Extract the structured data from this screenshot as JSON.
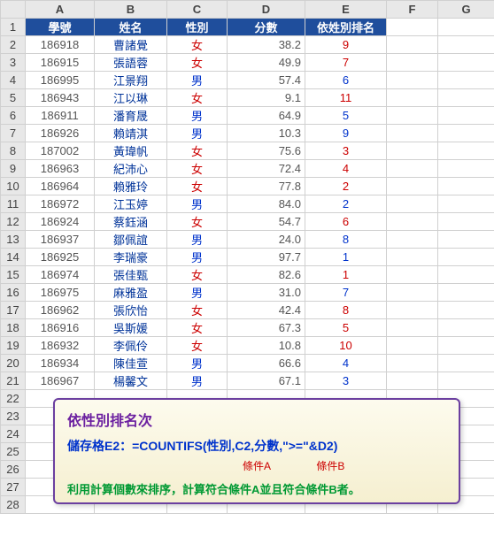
{
  "columns": [
    "A",
    "B",
    "C",
    "D",
    "E",
    "F",
    "G"
  ],
  "headers": {
    "A": "學號",
    "B": "姓名",
    "C": "性別",
    "D": "分數",
    "E": "依姓別排名"
  },
  "chart_data": {
    "type": "table",
    "title": "依性別排名次",
    "columns": [
      "學號",
      "姓名",
      "性別",
      "分數",
      "依姓別排名"
    ],
    "rows": [
      {
        "id": "186918",
        "name": "曹諸覺",
        "gender": "女",
        "score": 38.2,
        "rank": 9
      },
      {
        "id": "186915",
        "name": "張語蓉",
        "gender": "女",
        "score": 49.9,
        "rank": 7
      },
      {
        "id": "186995",
        "name": "江景翔",
        "gender": "男",
        "score": 57.4,
        "rank": 6
      },
      {
        "id": "186943",
        "name": "江以琳",
        "gender": "女",
        "score": 9.1,
        "rank": 11
      },
      {
        "id": "186911",
        "name": "潘育晟",
        "gender": "男",
        "score": 64.9,
        "rank": 5
      },
      {
        "id": "186926",
        "name": "賴靖淇",
        "gender": "男",
        "score": 10.3,
        "rank": 9
      },
      {
        "id": "187002",
        "name": "黃瑋帆",
        "gender": "女",
        "score": 75.6,
        "rank": 3
      },
      {
        "id": "186963",
        "name": "紀沛心",
        "gender": "女",
        "score": 72.4,
        "rank": 4
      },
      {
        "id": "186964",
        "name": "賴雅玲",
        "gender": "女",
        "score": 77.8,
        "rank": 2
      },
      {
        "id": "186972",
        "name": "江玉婷",
        "gender": "男",
        "score": 84.0,
        "rank": 2
      },
      {
        "id": "186924",
        "name": "蔡鈺涵",
        "gender": "女",
        "score": 54.7,
        "rank": 6
      },
      {
        "id": "186937",
        "name": "鄒佩誼",
        "gender": "男",
        "score": 24.0,
        "rank": 8
      },
      {
        "id": "186925",
        "name": "李瑞豪",
        "gender": "男",
        "score": 97.7,
        "rank": 1
      },
      {
        "id": "186974",
        "name": "張佳甄",
        "gender": "女",
        "score": 82.6,
        "rank": 1
      },
      {
        "id": "186975",
        "name": "麻雅盈",
        "gender": "男",
        "score": 31.0,
        "rank": 7
      },
      {
        "id": "186962",
        "name": "張欣怡",
        "gender": "女",
        "score": 42.4,
        "rank": 8
      },
      {
        "id": "186916",
        "name": "吳斯媛",
        "gender": "女",
        "score": 67.3,
        "rank": 5
      },
      {
        "id": "186932",
        "name": "李佩伶",
        "gender": "女",
        "score": 10.8,
        "rank": 10
      },
      {
        "id": "186934",
        "name": "陳佳萱",
        "gender": "男",
        "score": 66.6,
        "rank": 4
      },
      {
        "id": "186967",
        "name": "楊馨文",
        "gender": "男",
        "score": 67.1,
        "rank": 3
      }
    ]
  },
  "box": {
    "title": "依性別排名次",
    "formula": "儲存格E2：=COUNTIFS(性別,C2,分數,\">=\"&D2)",
    "condA": "條件A",
    "condB": "條件B",
    "note": "利用計算個數來排序，計算符合條件A並且符合條件B者。"
  }
}
